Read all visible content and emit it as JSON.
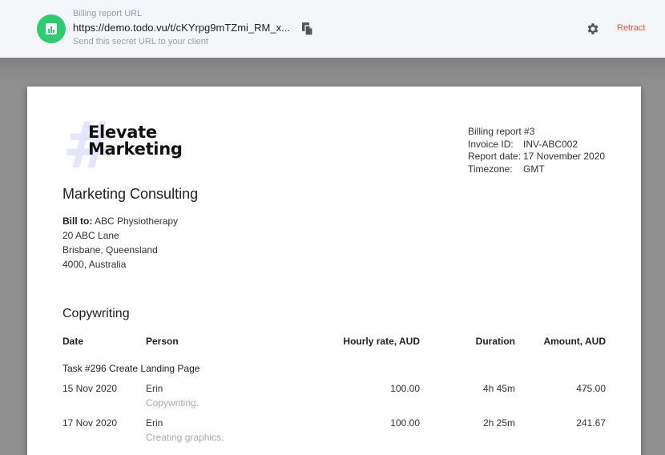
{
  "header": {
    "url_label": "Billing report URL",
    "url": "https://demo.todo.vu/t/cKYrpg9mTZmi_RM_x...",
    "url_hint": "Send this secret URL to your client",
    "retract_label": "Retract",
    "icons": {
      "app": "chart-icon",
      "copy": "copy-icon",
      "settings": "gear-icon"
    },
    "colors": {
      "app_icon_bg": "#2ecc71",
      "retract": "#e5534b"
    }
  },
  "report": {
    "logo": {
      "line1": "Elevate",
      "line2": "Marketing"
    },
    "title": "Billing report #3",
    "invoice_label": "Invoice ID:",
    "invoice_value": "INV-ABC002",
    "date_label": "Report date:",
    "date_value": "17 November 2020",
    "tz_label": "Timezone:",
    "tz_value": "GMT",
    "company": "Marketing Consulting",
    "bill_to_label": "Bill to:",
    "bill_to_name": "ABC Physiotherapy",
    "address": [
      "20 ABC Lane",
      "Brisbane, Queensland",
      "4000, Australia"
    ]
  },
  "section": {
    "title": "Copywriting",
    "columns": [
      "Date",
      "Person",
      "Hourly rate, AUD",
      "Duration",
      "Amount, AUD"
    ],
    "task": "Task #296 Create Landing Page",
    "rows": [
      {
        "date": "15 Nov 2020",
        "person": "Erin",
        "note": "Copywriting.",
        "rate": "100.00",
        "duration": "4h 45m",
        "amount": "475.00"
      },
      {
        "date": "17 Nov 2020",
        "person": "Erin",
        "note": "Creating graphics.",
        "rate": "100.00",
        "duration": "2h 25m",
        "amount": "241.67"
      }
    ]
  }
}
